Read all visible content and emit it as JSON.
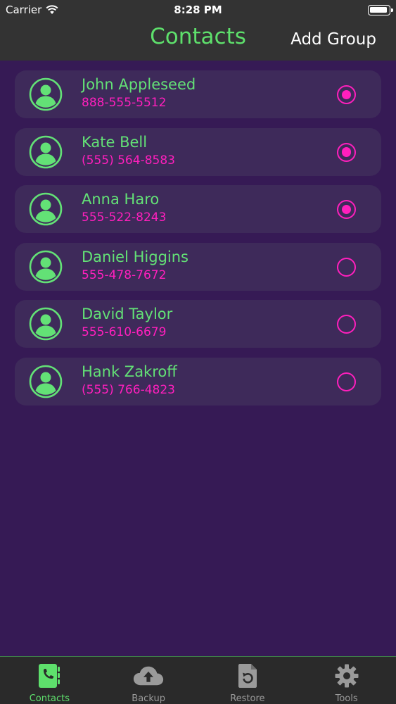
{
  "status_bar": {
    "carrier": "Carrier",
    "time": "8:28 PM"
  },
  "nav": {
    "title": "Contacts",
    "right_button": "Add Group"
  },
  "contacts": [
    {
      "name": "John Appleseed",
      "phone": "888-555-5512",
      "selected": true
    },
    {
      "name": "Kate Bell",
      "phone": "(555) 564-8583",
      "selected": true
    },
    {
      "name": "Anna Haro",
      "phone": "555-522-8243",
      "selected": true
    },
    {
      "name": "Daniel Higgins",
      "phone": "555-478-7672",
      "selected": false
    },
    {
      "name": "David Taylor",
      "phone": "555-610-6679",
      "selected": false
    },
    {
      "name": "Hank Zakroff",
      "phone": "(555) 766-4823",
      "selected": false
    }
  ],
  "tabs": [
    {
      "label": "Contacts",
      "icon": "contacts-book-icon",
      "active": true
    },
    {
      "label": "Backup",
      "icon": "cloud-upload-icon",
      "active": false
    },
    {
      "label": "Restore",
      "icon": "restore-file-icon",
      "active": false
    },
    {
      "label": "Tools",
      "icon": "gear-icon",
      "active": false
    }
  ],
  "colors": {
    "background": "#361a55",
    "card": "#3e2a5a",
    "accent_green": "#5ee06c",
    "accent_pink": "#ff1fbd",
    "bar": "#333333"
  }
}
